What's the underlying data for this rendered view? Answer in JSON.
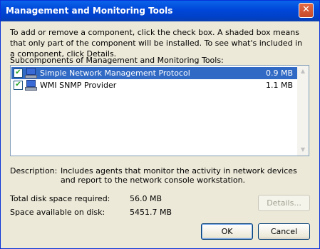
{
  "window": {
    "title": "Management and Monitoring Tools",
    "close_glyph": "✕"
  },
  "intro_text": "To add or remove a component, click the check box. A shaded box means that only part of the component will be installed. To see what's included in a component, click Details.",
  "subcomponents_label": "Subcomponents of Management and Monitoring Tools:",
  "components": [
    {
      "name": "Simple Network Management Protocol",
      "size": "0.9 MB",
      "checked": true,
      "selected": true
    },
    {
      "name": "WMI SNMP Provider",
      "size": "1.1 MB",
      "checked": true,
      "selected": false
    }
  ],
  "description": {
    "label": "Description:",
    "text": "Includes agents that monitor the activity in network devices and report to the network console workstation."
  },
  "disk": {
    "total_label": "Total disk space required:",
    "total_value": "56.0 MB",
    "available_label": "Space available on disk:",
    "available_value": "5451.7 MB"
  },
  "buttons": {
    "details": "Details...",
    "ok": "OK",
    "cancel": "Cancel"
  },
  "icons": {
    "component": "network-computer-icon",
    "check": "✔"
  }
}
